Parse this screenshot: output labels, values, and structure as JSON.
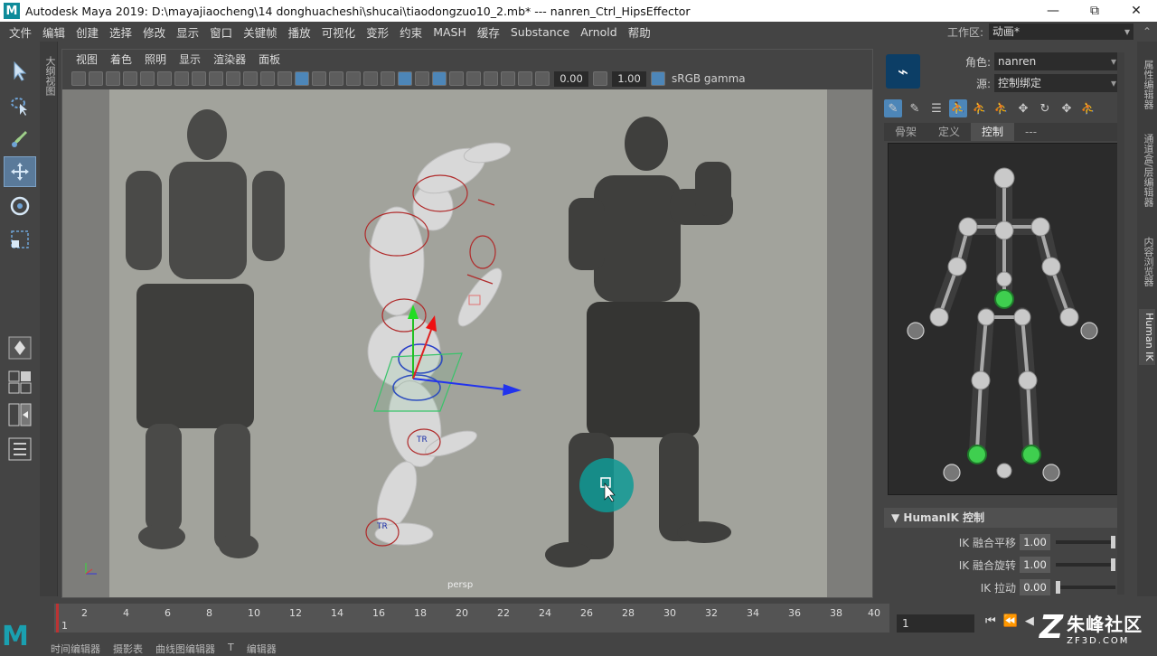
{
  "titlebar": {
    "logo": "M",
    "title": "Autodesk Maya 2019: D:\\mayajiaocheng\\14 donghuacheshi\\shucai\\tiaodongzuo10_2.mb*   ---   nanren_Ctrl_HipsEffector",
    "min": "—",
    "max": "⧉",
    "close": "✕"
  },
  "menubar": {
    "items": [
      "文件",
      "编辑",
      "创建",
      "选择",
      "修改",
      "显示",
      "窗口",
      "关键帧",
      "播放",
      "可视化",
      "变形",
      "约束",
      "MASH",
      "缓存",
      "Substance",
      "Arnold",
      "帮助"
    ],
    "workspace_label": "工作区:",
    "workspace_value": "动画*"
  },
  "outliner_tab": "大纲视图",
  "viewport": {
    "menu": [
      "视图",
      "着色",
      "照明",
      "显示",
      "渲染器",
      "面板"
    ],
    "field1": "0.00",
    "field2": "1.00",
    "colorspace": "sRGB gamma",
    "camera": "persp"
  },
  "right_strip": {
    "tabs": [
      "属性编辑器",
      "通道盒/层编辑器",
      "内容浏览器",
      "Human IK"
    ]
  },
  "hik": {
    "character_label": "角色:",
    "character_value": "nanren",
    "source_label": "源:",
    "source_value": "控制绑定",
    "tabs": [
      "骨架",
      "定义",
      "控制",
      "---"
    ],
    "section_title": "HumanIK 控制",
    "sliders": [
      {
        "label": "IK 融合平移",
        "value": "1.00",
        "level": 1.0
      },
      {
        "label": "IK 融合旋转",
        "value": "1.00",
        "level": 1.0
      },
      {
        "label": "IK 拉动",
        "value": "0.00",
        "level": 0.0
      }
    ],
    "controls": [
      "TR",
      "TR"
    ]
  },
  "timeline": {
    "ticks": [
      "1",
      "2",
      "4",
      "6",
      "8",
      "10",
      "12",
      "14",
      "16",
      "18",
      "20",
      "22",
      "24",
      "26",
      "28",
      "30",
      "32",
      "34",
      "36",
      "38",
      "40"
    ],
    "current_frame": "1",
    "play_buttons": [
      "⏮",
      "⏪",
      "◀"
    ]
  },
  "bottom_tabs": [
    "时间编辑器",
    "摄影表",
    "曲线图编辑器",
    "T",
    "编辑器"
  ],
  "watermark": {
    "mark": "Z",
    "cn": "朱峰社区",
    "en": "ZF3D.COM"
  },
  "maya_logo": "M",
  "colors": {
    "accent": "#4d86b8",
    "active_green": "#3fcf4f",
    "teal_cursor": "#0f9a95"
  }
}
